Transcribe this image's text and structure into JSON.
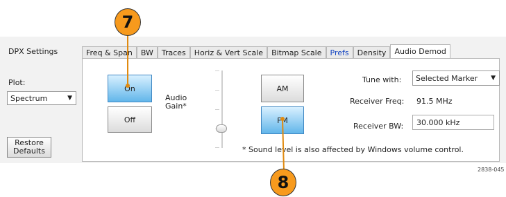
{
  "panel": {
    "title": "DPX Settings",
    "restore_label": "Restore Defaults"
  },
  "tabs": [
    {
      "label": "Freq & Span"
    },
    {
      "label": "BW"
    },
    {
      "label": "Traces"
    },
    {
      "label": "Horiz & Vert Scale"
    },
    {
      "label": "Bitmap Scale"
    },
    {
      "label": "Prefs"
    },
    {
      "label": "Density"
    },
    {
      "label": "Audio Demod"
    }
  ],
  "plot": {
    "label": "Plot:",
    "value": "Spectrum"
  },
  "audio": {
    "on_label": "On",
    "off_label": "Off",
    "gain_label": "Audio Gain*",
    "am_label": "AM",
    "fm_label": "FM",
    "tune_label": "Tune with:",
    "tune_value": "Selected Marker",
    "receiver_freq_label": "Receiver Freq:",
    "receiver_freq_value": "91.5 MHz",
    "receiver_bw_label": "Receiver BW:",
    "receiver_bw_value": "30.000 kHz",
    "footnote": "* Sound level is also affected by Windows volume control.",
    "gain_level": 0.25
  },
  "callouts": {
    "seven": "7",
    "eight": "8"
  },
  "figure_id": "2838-045",
  "colors": {
    "callout_fill": "#f79a1d",
    "selected_button": "#62b6ea",
    "prefs_tab_text": "#1546c2"
  }
}
